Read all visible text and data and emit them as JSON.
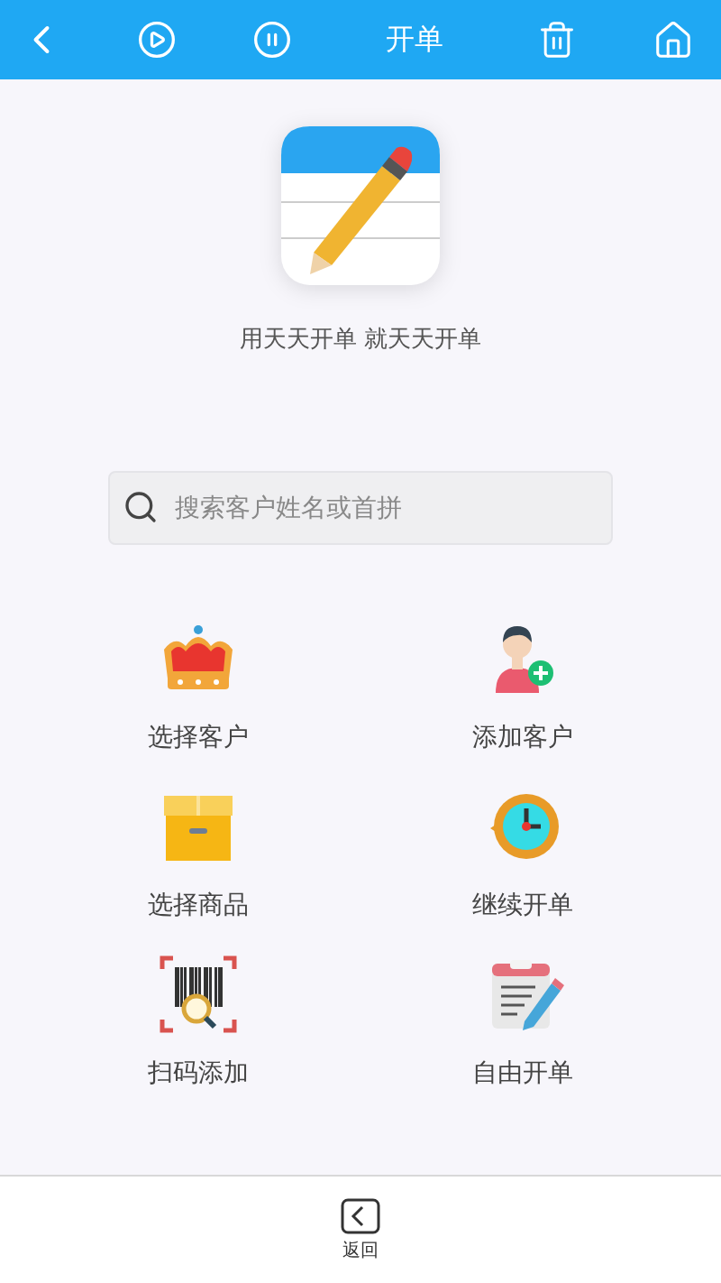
{
  "header": {
    "title": "开单"
  },
  "tagline": "用天天开单 就天天开单",
  "search": {
    "placeholder": "搜索客户姓名或首拼"
  },
  "actions": [
    {
      "kind": "crown",
      "label": "选择客户"
    },
    {
      "kind": "add-person",
      "label": "添加客户"
    },
    {
      "kind": "box",
      "label": "选择商品"
    },
    {
      "kind": "clock",
      "label": "继续开单"
    },
    {
      "kind": "barcode",
      "label": "扫码添加"
    },
    {
      "kind": "note",
      "label": "自由开单"
    }
  ],
  "bottom_bar": {
    "back_label": "返回"
  }
}
